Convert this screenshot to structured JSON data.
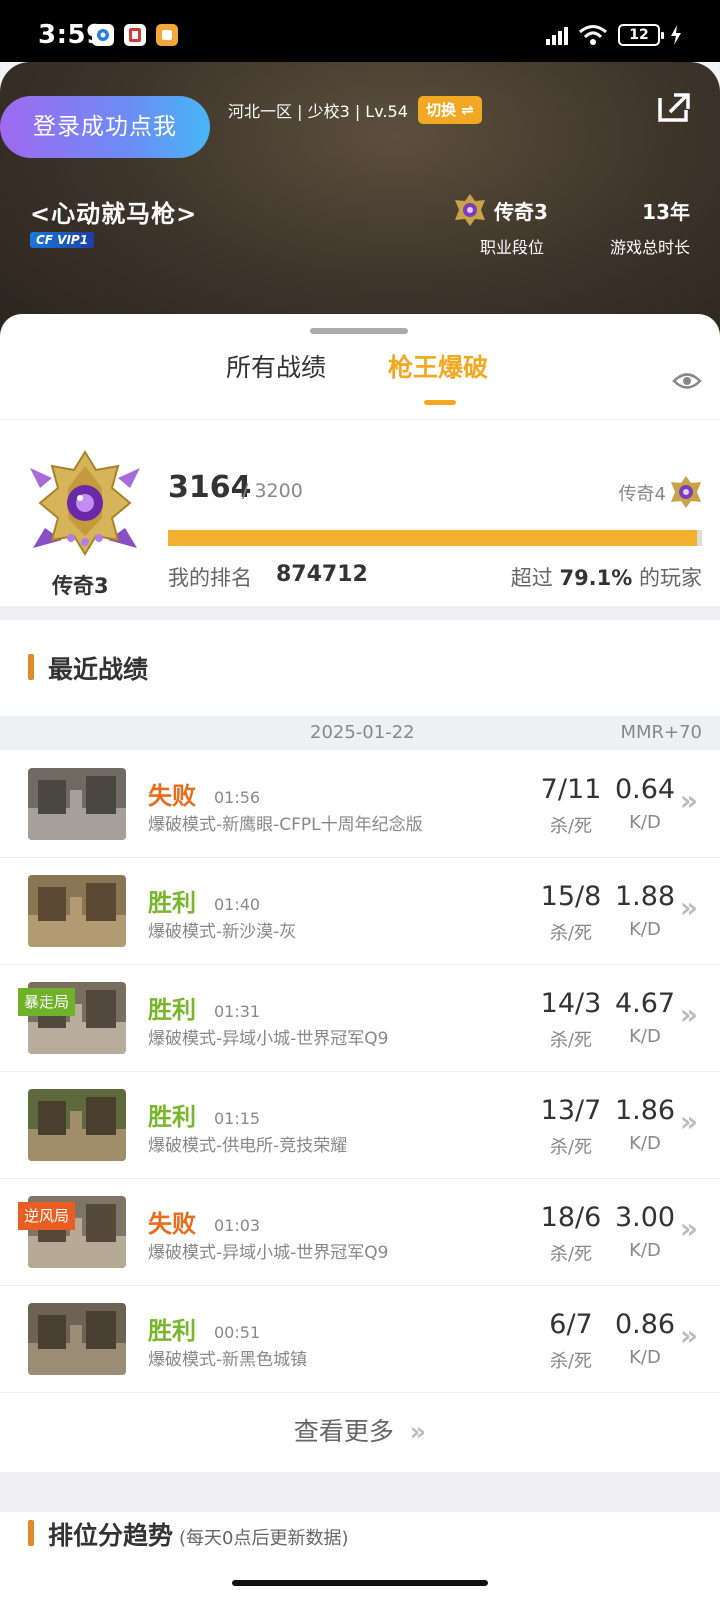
{
  "status_bar": {
    "time": "3:59",
    "battery": "12"
  },
  "header": {
    "login_button": "登录成功点我",
    "server": "河北一区 | 少校3 | Lv.54",
    "switch": "切换 ⇌",
    "nickname": "<心动就马枪>",
    "vip": "CF VIP1",
    "rank_name": "传奇3",
    "rank_label": "职业段位",
    "years": "13年",
    "years_label": "游戏总时长"
  },
  "tabs": [
    {
      "label": "所有战绩",
      "active": false
    },
    {
      "label": "枪王爆破",
      "active": true
    }
  ],
  "rank_card": {
    "badge_name": "传奇3",
    "score": "3164",
    "score_max": "/ 3200",
    "next_rank": "传奇4",
    "progress_fraction": 0.99,
    "my_rank_label": "我的排名",
    "my_rank_value": "874712",
    "beat_prefix": "超过",
    "beat_value": "79.1%",
    "beat_suffix": "的玩家"
  },
  "recent": {
    "title": "最近战绩",
    "date": "2025-01-22",
    "mmr": "MMR+70",
    "matches": [
      {
        "result": "失败",
        "win": false,
        "duration": "01:56",
        "mode": "爆破模式-新鹰眼-CFPL十周年纪念版",
        "kills": "7/11",
        "kills_label": "杀/死",
        "kd": "0.64",
        "kd_label": "K/D",
        "tag": ""
      },
      {
        "result": "胜利",
        "win": true,
        "duration": "01:40",
        "mode": "爆破模式-新沙漠-灰",
        "kills": "15/8",
        "kills_label": "杀/死",
        "kd": "1.88",
        "kd_label": "K/D",
        "tag": ""
      },
      {
        "result": "胜利",
        "win": true,
        "duration": "01:31",
        "mode": "爆破模式-异域小城-世界冠军Q9",
        "kills": "14/3",
        "kills_label": "杀/死",
        "kd": "4.67",
        "kd_label": "K/D",
        "tag": "暴走局"
      },
      {
        "result": "胜利",
        "win": true,
        "duration": "01:15",
        "mode": "爆破模式-供电所-竞技荣耀",
        "kills": "13/7",
        "kills_label": "杀/死",
        "kd": "1.86",
        "kd_label": "K/D",
        "tag": ""
      },
      {
        "result": "失败",
        "win": false,
        "duration": "01:03",
        "mode": "爆破模式-异域小城-世界冠军Q9",
        "kills": "18/6",
        "kills_label": "杀/死",
        "kd": "3.00",
        "kd_label": "K/D",
        "tag": "逆风局"
      },
      {
        "result": "胜利",
        "win": true,
        "duration": "00:51",
        "mode": "爆破模式-新黑色城镇",
        "kills": "6/7",
        "kills_label": "杀/死",
        "kd": "0.86",
        "kd_label": "K/D",
        "tag": ""
      }
    ],
    "more": "查看更多",
    "more_arrow": "»"
  },
  "trend": {
    "title": "排位分趋势",
    "subtitle": "(每天0点后更新数据)"
  },
  "colors": {
    "accent": "#f3a824",
    "win": "#7ab62c",
    "lose": "#e66d1e",
    "tag_win": "#6fb22a",
    "tag_lose": "#e85e22"
  }
}
